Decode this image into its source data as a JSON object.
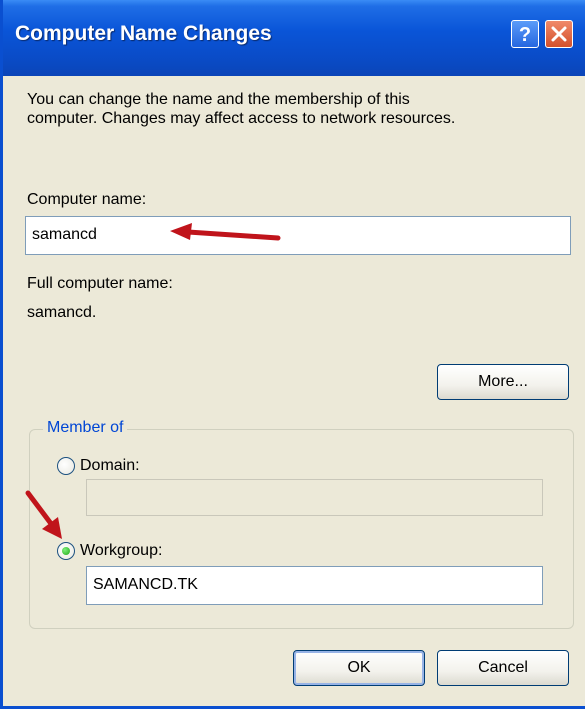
{
  "window": {
    "title": "Computer Name Changes"
  },
  "description": {
    "line1": "You can change the name and the membership of this",
    "line2": "computer. Changes may affect access to network resources."
  },
  "computer_name": {
    "label": "Computer name:",
    "value": "samancd"
  },
  "full_name": {
    "label": "Full computer name:",
    "value": "samancd."
  },
  "buttons": {
    "more": "More...",
    "ok": "OK",
    "cancel": "Cancel"
  },
  "membership": {
    "legend": "Member of",
    "domain": {
      "label": "Domain:",
      "value": "",
      "selected": false
    },
    "workgroup": {
      "label": "Workgroup:",
      "value": "SAMANCD.TK",
      "selected": true
    }
  },
  "icons": {
    "help": "help-icon",
    "close": "close-icon",
    "annotation": "red-arrow-icon"
  },
  "colors": {
    "titlebar": "#0a55d8",
    "group_legend": "#0046d5",
    "annotation_arrow": "#c0141b"
  }
}
